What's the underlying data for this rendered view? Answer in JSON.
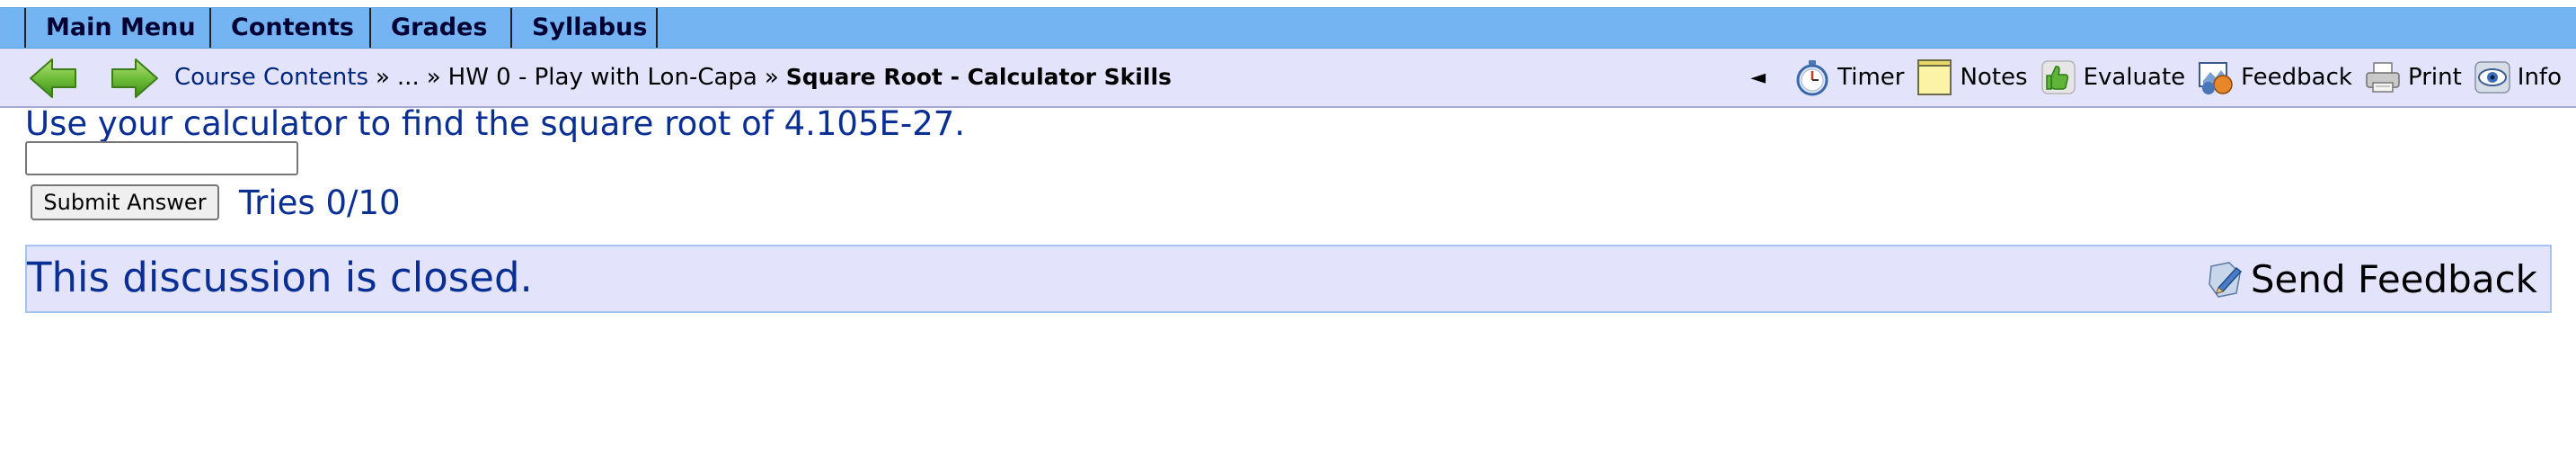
{
  "main_menu": {
    "items": [
      {
        "label": "Main Menu"
      },
      {
        "label": "Contents"
      },
      {
        "label": "Grades"
      },
      {
        "label": "Syllabus"
      }
    ]
  },
  "nav": {
    "back_icon": "left-arrow-icon",
    "forward_icon": "right-arrow-icon",
    "breadcrumb": {
      "course_contents": "Course Contents",
      "separator": "»",
      "ellipsis": "...",
      "folder": "HW 0 - Play with Lon-Capa",
      "current": "Square Root - Calculator Skills"
    },
    "collapse_symbol": "◄",
    "tools": [
      {
        "label": "Timer",
        "icon": "stopwatch-icon"
      },
      {
        "label": "Notes",
        "icon": "notepad-icon"
      },
      {
        "label": "Evaluate",
        "icon": "thumbs-up-icon"
      },
      {
        "label": "Feedback",
        "icon": "feedback-icon"
      },
      {
        "label": "Print",
        "icon": "printer-icon"
      },
      {
        "label": "Info",
        "icon": "eye-icon"
      }
    ]
  },
  "problem": {
    "question": "Use your calculator to find the square root of 4.105E-27.",
    "answer_value": "",
    "submit_label": "Submit Answer",
    "tries": "Tries 0/10"
  },
  "discussion": {
    "closed_text": "This discussion is closed.",
    "send_feedback_label": "Send Feedback",
    "send_feedback_icon": "pencil-feedback-icon"
  },
  "colors": {
    "menu_bar": "#75b4f3",
    "nav_bar": "#e3e4fc",
    "text_blue": "#0a2f94",
    "link_blue": "#00277f"
  }
}
